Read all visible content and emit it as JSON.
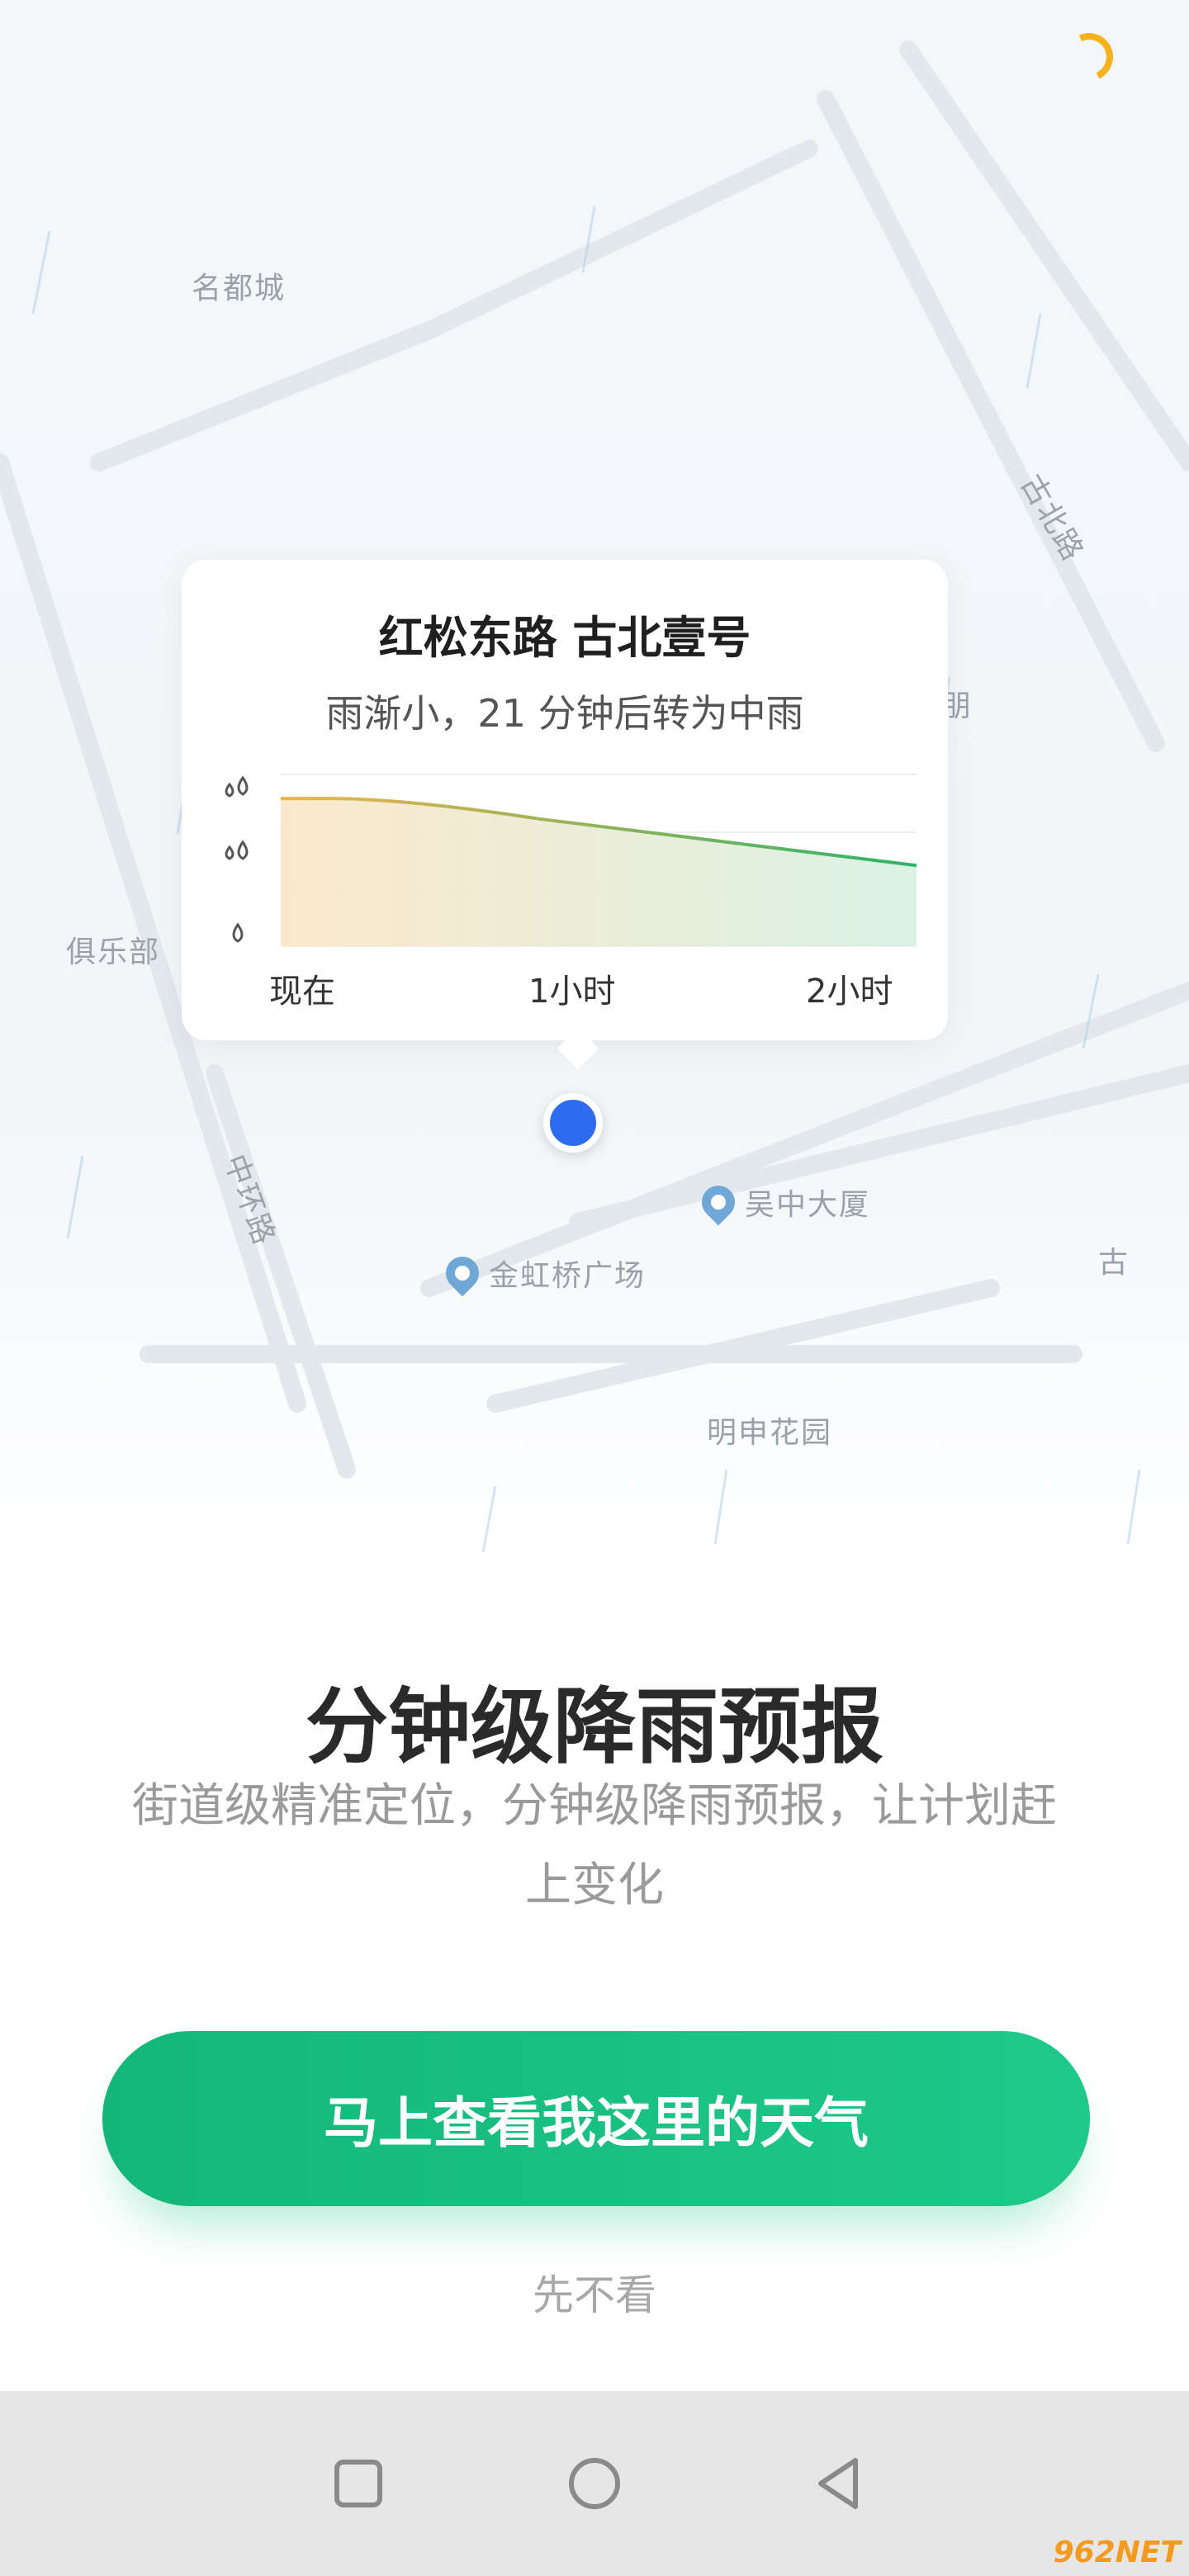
{
  "map": {
    "labels": [
      "名都城",
      "古北路",
      "朋",
      "俱乐部",
      "中环路",
      "吴中大厦",
      "金虹桥广场",
      "明申花园",
      "古"
    ]
  },
  "card": {
    "title": "红松东路 古北壹号",
    "subtitle": "雨渐小，21 分钟后转为中雨",
    "ticks": [
      "现在",
      "1小时",
      "2小时"
    ]
  },
  "chart_data": {
    "type": "area",
    "x": [
      "现在",
      "1小时",
      "2小时"
    ],
    "series": [
      {
        "values": [
          0.86,
          0.74,
          0.47
        ]
      }
    ],
    "yscale_icons": [
      "heavy-rain-icon",
      "moderate-rain-icon",
      "light-rain-icon"
    ],
    "ylim": [
      0,
      1
    ],
    "colors": [
      "#f2b34a",
      "#2db36a"
    ]
  },
  "headline": "分钟级降雨预报",
  "description": "街道级精准定位，分钟级降雨预报，让计划赶上变化",
  "cta_label": "马上查看我这里的天气",
  "skip_label": "先不看",
  "watermark": "962NET"
}
